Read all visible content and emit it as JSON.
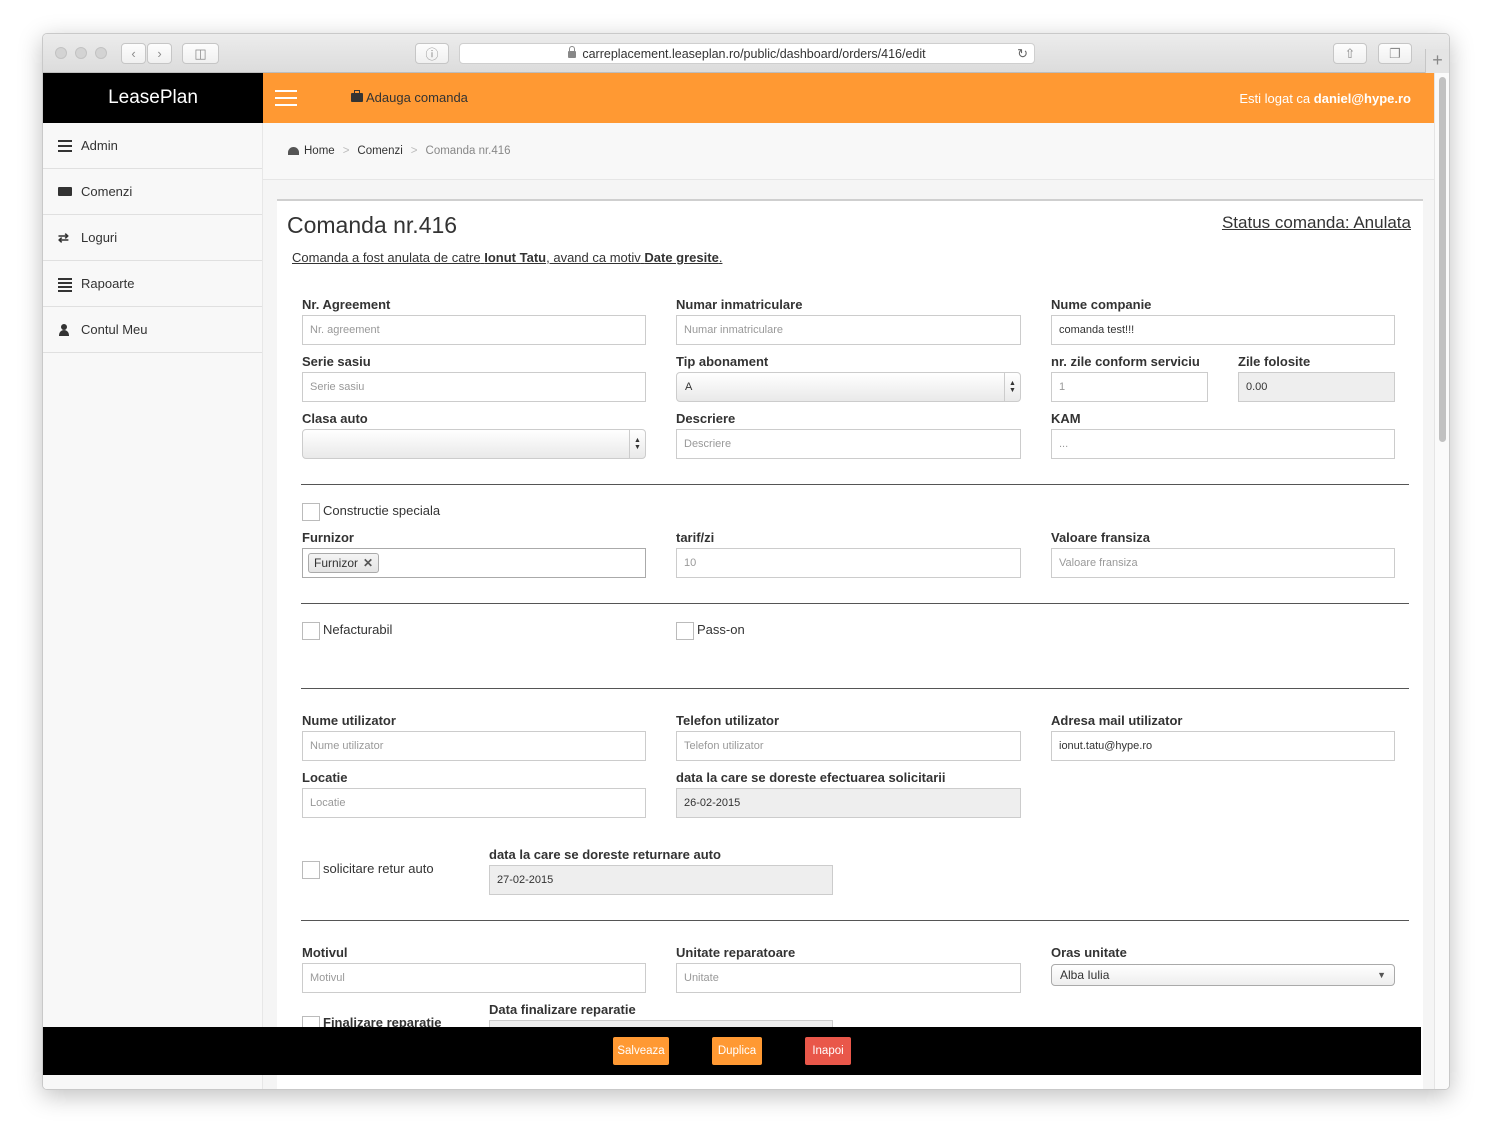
{
  "browser": {
    "url": "carreplacement.leaseplan.ro/public/dashboard/orders/416/edit"
  },
  "brand": "LeasePlan",
  "topnav": {
    "add_order": "Adauga comanda",
    "logged_prefix": "Esti logat ca",
    "logged_user": "daniel@hype.ro",
    "accent_color": "#ff9933"
  },
  "sidebar": {
    "items": [
      {
        "label": "Admin",
        "icon": "bars-icon"
      },
      {
        "label": "Comenzi",
        "icon": "briefcase-icon"
      },
      {
        "label": "Loguri",
        "icon": "exchange-icon"
      },
      {
        "label": "Rapoarte",
        "icon": "list-icon"
      },
      {
        "label": "Contul Meu",
        "icon": "user-icon"
      }
    ]
  },
  "breadcrumb": {
    "home": "Home",
    "orders": "Comenzi",
    "current": "Comanda nr.416"
  },
  "page": {
    "title": "Comanda nr.416",
    "status": "Status comanda: Anulata",
    "cancel_prefix": "Comanda a fost anulata de catre",
    "cancel_user": "Ionut Tatu",
    "cancel_mid": ", avand ca motiv",
    "cancel_reason": "Date gresite",
    "cancel_end": "."
  },
  "form": {
    "agreement": {
      "label": "Nr. Agreement",
      "placeholder": "Nr. agreement",
      "value": ""
    },
    "plate": {
      "label": "Numar inmatriculare",
      "placeholder": "Numar inmatriculare",
      "value": ""
    },
    "company": {
      "label": "Nume companie",
      "value": "comanda test!!!"
    },
    "chassis": {
      "label": "Serie sasiu",
      "placeholder": "Serie sasiu"
    },
    "subscription": {
      "label": "Tip abonament",
      "value": "A"
    },
    "service_days": {
      "label": "nr. zile conform serviciu",
      "placeholder": "1"
    },
    "used_days": {
      "label": "Zile folosite",
      "value": "0.00"
    },
    "car_class": {
      "label": "Clasa auto",
      "value": ""
    },
    "description": {
      "label": "Descriere",
      "placeholder": "Descriere"
    },
    "kam": {
      "label": "KAM",
      "placeholder": "..."
    },
    "special": {
      "label": "Constructie speciala"
    },
    "supplier": {
      "label": "Furnizor",
      "tag": "Furnizor"
    },
    "rate": {
      "label": "tarif/zi",
      "placeholder": "10"
    },
    "franchise": {
      "label": "Valoare fransiza",
      "placeholder": "Valoare fransiza"
    },
    "non_billable": {
      "label": "Nefacturabil"
    },
    "pass_on": {
      "label": "Pass-on"
    },
    "user_name": {
      "label": "Nume utilizator",
      "placeholder": "Nume utilizator"
    },
    "user_phone": {
      "label": "Telefon utilizator",
      "placeholder": "Telefon utilizator"
    },
    "user_email": {
      "label": "Adresa mail utilizator",
      "value": "ionut.tatu@hype.ro"
    },
    "location": {
      "label": "Locatie",
      "placeholder": "Locatie"
    },
    "request_date": {
      "label": "data la care se doreste efectuarea solicitarii",
      "value": "26-02-2015"
    },
    "return_request": {
      "label": "solicitare retur auto"
    },
    "return_date": {
      "label": "data la care se doreste returnare auto",
      "value": "27-02-2015"
    },
    "reason": {
      "label": "Motivul",
      "placeholder": "Motivul"
    },
    "repair_unit": {
      "label": "Unitate reparatoare",
      "placeholder": "Unitate"
    },
    "unit_city": {
      "label": "Oras unitate",
      "value": "Alba Iulia"
    },
    "repair_done": {
      "label": "Finalizare reparatie"
    },
    "repair_date": {
      "label": "Data finalizare reparatie"
    }
  },
  "footer": {
    "save": "Salveaza",
    "duplicate": "Duplica",
    "back": "Inapoi",
    "save_color": "#ff9933",
    "back_color": "#e9574a"
  }
}
